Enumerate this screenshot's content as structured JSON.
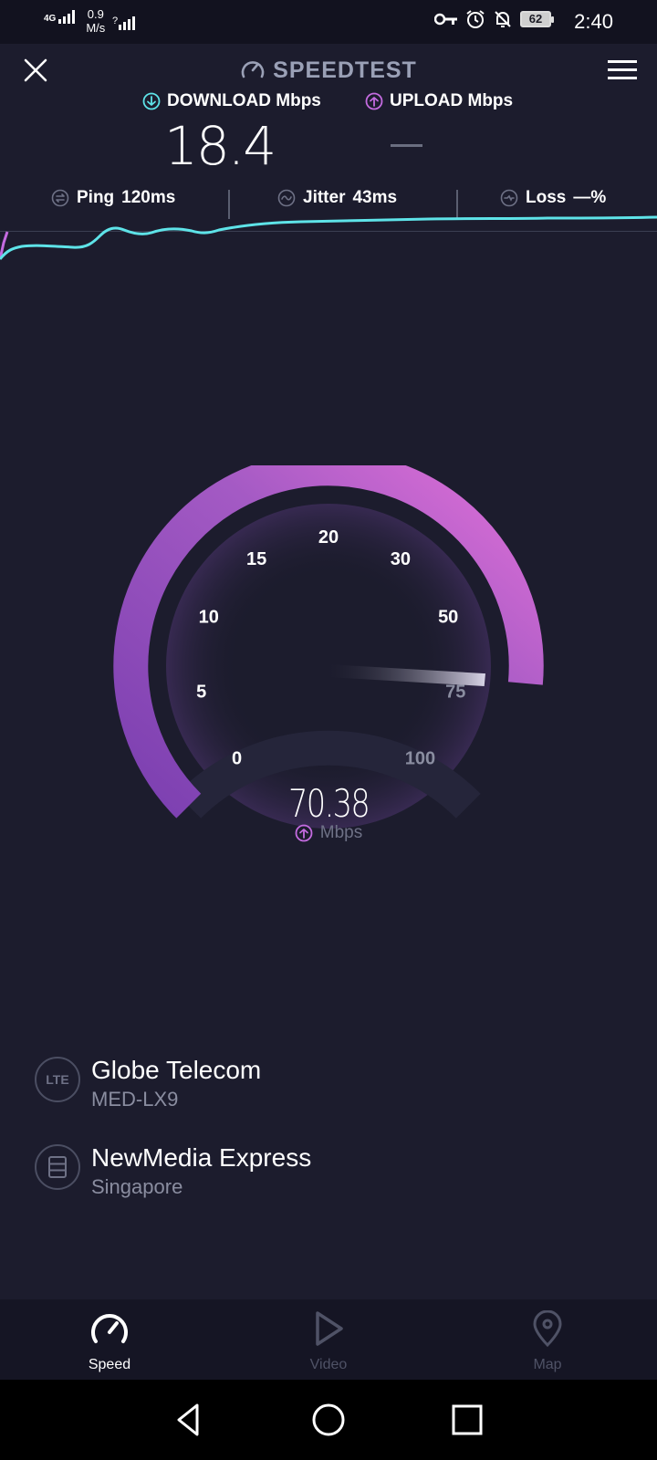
{
  "status_bar": {
    "network_type": "4G",
    "network_speed_value": "0.9",
    "network_speed_unit": "M/s",
    "battery": "62",
    "time": "2:40"
  },
  "header": {
    "title": "SPEEDTEST"
  },
  "results": {
    "download_label": "DOWNLOAD Mbps",
    "download_value": "18.4",
    "upload_label": "UPLOAD Mbps"
  },
  "metrics": {
    "ping_label": "Ping",
    "ping_value": "120ms",
    "jitter_label": "Jitter",
    "jitter_value": "43ms",
    "loss_label": "Loss",
    "loss_value": "—%"
  },
  "gauge": {
    "scale_labels": [
      "0",
      "5",
      "10",
      "15",
      "20",
      "30",
      "50",
      "75",
      "100"
    ],
    "current_value": "70.38",
    "unit": "Mbps"
  },
  "provider": {
    "isp_icon_label": "LTE",
    "isp_name": "Globe Telecom",
    "device": "MED-LX9",
    "server_name": "NewMedia Express",
    "server_location": "Singapore"
  },
  "bottom_nav": {
    "speed": "Speed",
    "video": "Video",
    "map": "Map"
  },
  "colors": {
    "background": "#1c1c2d",
    "download_accent": "#5ee3e8",
    "upload_accent": "#c46be0",
    "gauge_start": "#7b3fb0",
    "gauge_end": "#e070d8"
  }
}
